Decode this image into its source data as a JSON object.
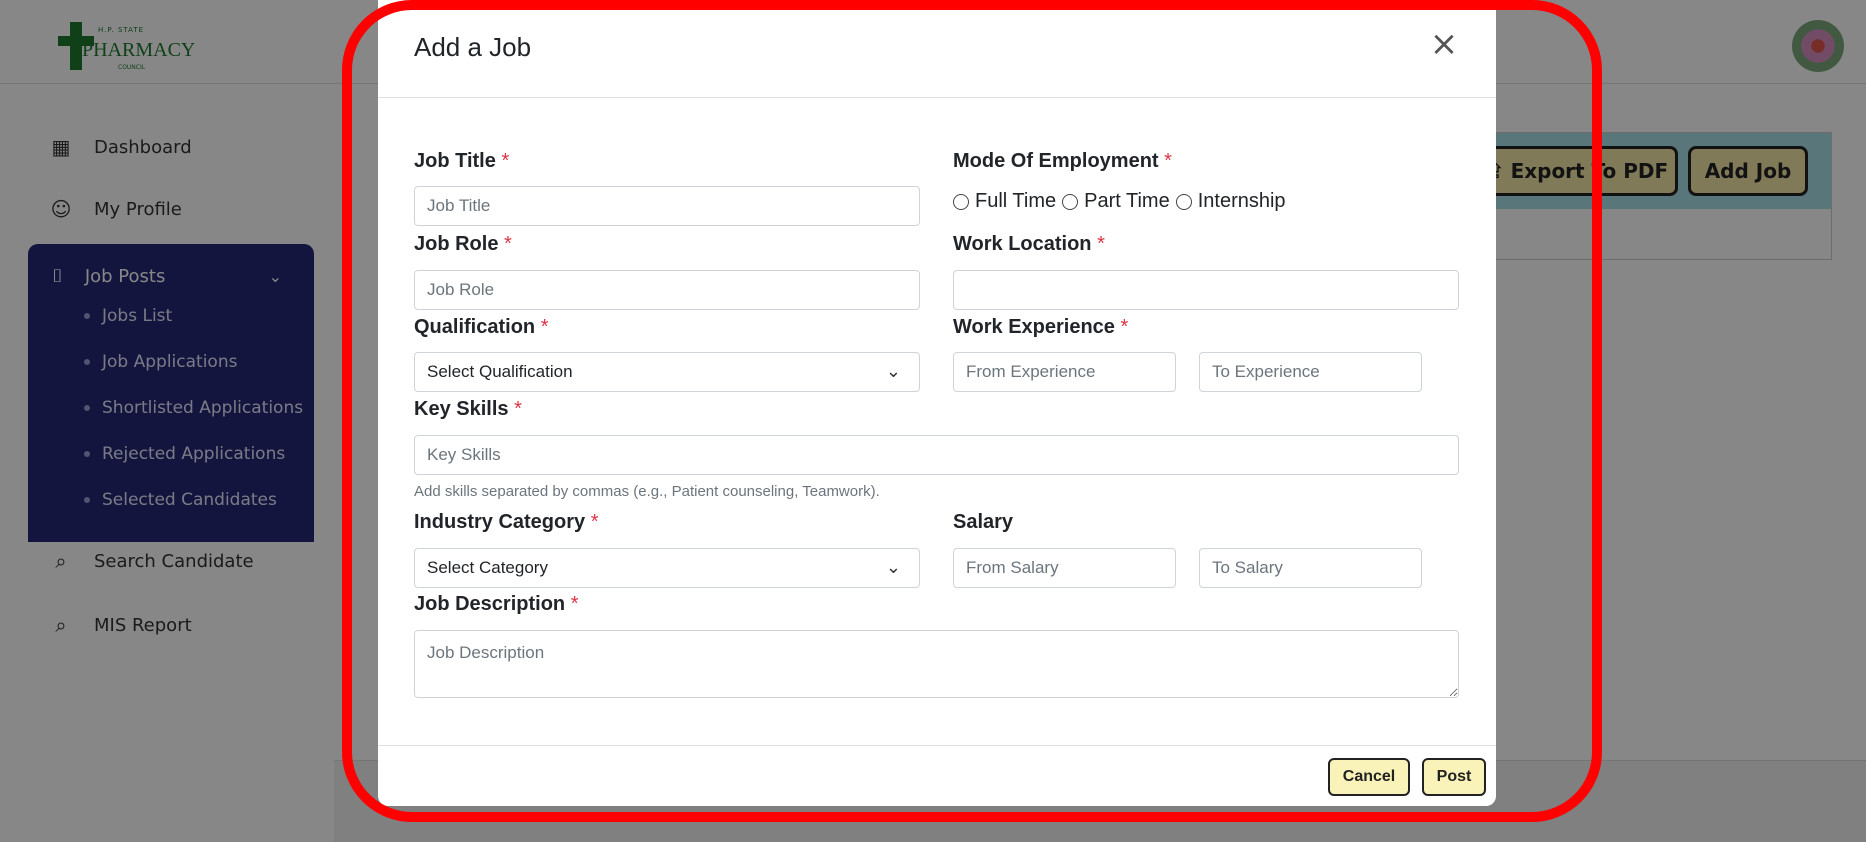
{
  "logo": {
    "top_text": "H.P. STATE",
    "main_text": "PHARMACY",
    "sub_text": "COUNCIL"
  },
  "sidebar": {
    "dashboard": "Dashboard",
    "my_profile": "My Profile",
    "job_posts": "Job Posts",
    "sub_items": [
      "Jobs List",
      "Job Applications",
      "Shortlisted Applications",
      "Rejected Applications",
      "Selected Candidates"
    ],
    "search_candidate": "Search Candidate",
    "mis_report": "MIS Report"
  },
  "background_buttons": {
    "export": "Export To PDF",
    "add_job": "Add Job"
  },
  "modal": {
    "title": "Add a Job",
    "job_title": {
      "label": "Job Title",
      "placeholder": "Job Title"
    },
    "mode_of_employment": {
      "label": "Mode Of Employment",
      "options": [
        "Full Time",
        "Part Time",
        "Internship"
      ]
    },
    "job_role": {
      "label": "Job Role",
      "placeholder": "Job Role"
    },
    "work_location": {
      "label": "Work Location",
      "placeholder": ""
    },
    "qualification": {
      "label": "Qualification",
      "selected": "Select Qualification"
    },
    "work_experience": {
      "label": "Work Experience",
      "from_placeholder": "From Experience",
      "to_placeholder": "To Experience"
    },
    "key_skills": {
      "label": "Key Skills",
      "placeholder": "Key Skills",
      "help": "Add skills separated by commas (e.g., Patient counseling, Teamwork)."
    },
    "industry_category": {
      "label": "Industry Category",
      "selected": "Select Category"
    },
    "salary": {
      "label": "Salary",
      "from_placeholder": "From Salary",
      "to_placeholder": "To Salary"
    },
    "job_description": {
      "label": "Job Description",
      "placeholder": "Job Description"
    },
    "required_marker": "*",
    "cancel": "Cancel",
    "post": "Post"
  },
  "colors": {
    "sidebar_active": "#242876",
    "button_bg": "#f9f3b9",
    "highlight": "#ff0000",
    "required": "#dc3545"
  }
}
